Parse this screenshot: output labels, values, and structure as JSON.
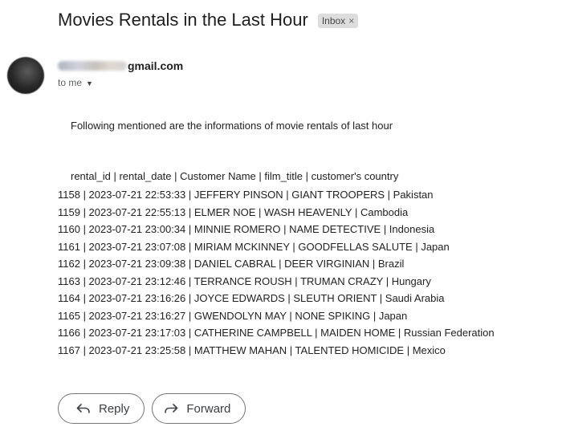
{
  "email": {
    "subject": "Movies Rentals in the Last Hour",
    "label": "Inbox",
    "label_close": "×",
    "sender_visible": "gmail.com",
    "recipient": "to me",
    "intro": "Following mentioned are the informations of movie rentals of last hour",
    "table_header": "rental_id | rental_date | Customer Name | film_title | customer's country",
    "rows": [
      "1158 | 2023-07-21 22:53:33 | JEFFERY PINSON | GIANT TROOPERS | Pakistan",
      "1159 | 2023-07-21 22:55:13 | ELMER NOE | WASH HEAVENLY | Cambodia",
      "1160 | 2023-07-21 23:00:34 | MINNIE ROMERO | NAME DETECTIVE | Indonesia",
      "1161 | 2023-07-21 23:07:08 | MIRIAM MCKINNEY | GOODFELLAS SALUTE | Japan",
      "1162 | 2023-07-21 23:09:38 | DANIEL CABRAL | DEER VIRGINIAN | Brazil",
      "1163 | 2023-07-21 23:12:46 | TERRANCE ROUSH | TRUMAN CRAZY | Hungary",
      "1164 | 2023-07-21 23:16:26 | JOYCE EDWARDS | SLEUTH ORIENT | Saudi Arabia",
      "1165 | 2023-07-21 23:16:27 | GWENDOLYN MAY | NONE SPIKING | Japan",
      "1166 | 2023-07-21 23:17:03 | CATHERINE CAMPBELL | MAIDEN HOME | Russian Federation",
      "1167 | 2023-07-21 23:25:58 | MATTHEW MAHAN | TALENTED HOMICIDE | Mexico"
    ]
  },
  "actions": {
    "reply_label": "Reply",
    "forward_label": "Forward"
  },
  "icons": {
    "reply": "reply-arrow-icon",
    "forward": "forward-arrow-icon",
    "dropdown": "caret-down-icon"
  }
}
